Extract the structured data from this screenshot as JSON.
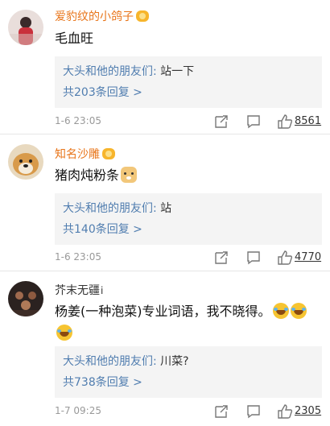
{
  "comments": [
    {
      "user": "爱豹纹的小鸽子",
      "text": "毛血旺",
      "reply": {
        "author": "大头和他的朋友们",
        "sep": ":",
        "content": "站一下",
        "count_text": "共203条回复 >"
      },
      "time": "1-6 23:05",
      "likes": "8561",
      "icons": {
        "badge": "vip-badge-icon",
        "repost": "repost-icon",
        "comment": "comment-icon",
        "like": "thumbs-up-icon"
      }
    },
    {
      "user": "知名沙雕",
      "text": "猪肉炖粉条",
      "reply": {
        "author": "大头和他的朋友们",
        "sep": ":",
        "content": "站",
        "count_text": "共140条回复 >"
      },
      "time": "1-6 23:05",
      "likes": "4770",
      "icons": {
        "badge": "vip-badge-icon",
        "emoji": "dog-emoji-icon",
        "repost": "repost-icon",
        "comment": "comment-icon",
        "like": "thumbs-up-icon"
      }
    },
    {
      "user": "芥末无疆",
      "level": "i",
      "text": "杨姜(一种泡菜)专业词语，我不晓得。",
      "reply": {
        "author": "大头和他的朋友们",
        "sep": ":",
        "content": "川菜?",
        "count_text": "共738条回复 >"
      },
      "time": "1-7 09:25",
      "likes": "2305",
      "icons": {
        "emoji": "laughing-crying-emoji-icon",
        "repost": "repost-icon",
        "comment": "comment-icon",
        "like": "thumbs-up-icon"
      }
    }
  ],
  "colors": {
    "username_orange": "#e8751a",
    "link_blue": "#507daf",
    "reply_bg": "#f4f4f4",
    "meta_gray": "#999999",
    "icon_gray": "#888888"
  }
}
